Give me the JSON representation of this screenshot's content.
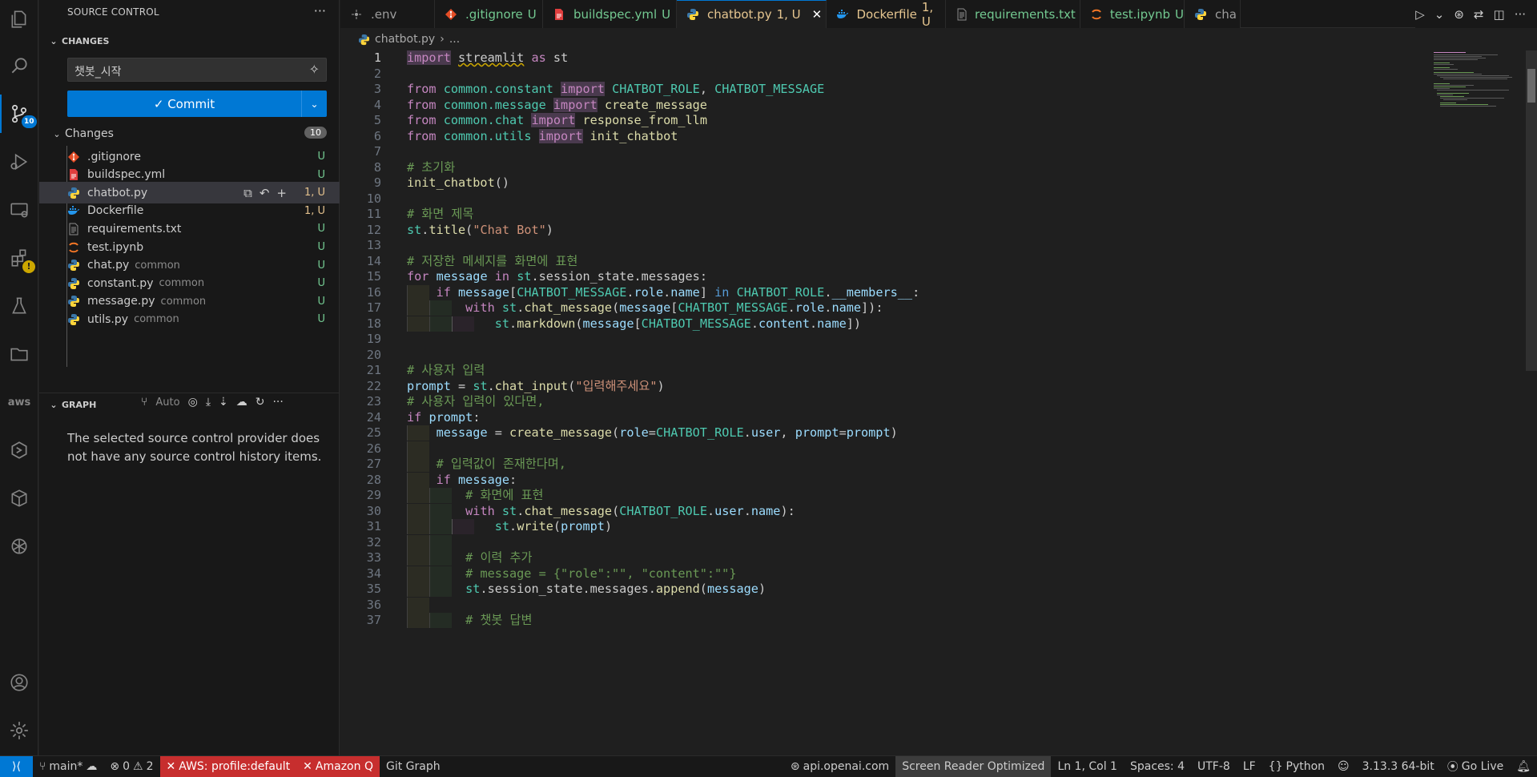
{
  "activity_bar": {
    "items": [
      {
        "name": "explorer-icon"
      },
      {
        "name": "search-icon"
      },
      {
        "name": "source-control-icon",
        "badge": "10"
      },
      {
        "name": "run-debug-icon"
      },
      {
        "name": "remote-explorer-icon"
      },
      {
        "name": "extensions-icon",
        "badge": "!"
      },
      {
        "name": "testing-icon"
      },
      {
        "name": "folder-icon"
      },
      {
        "name": "aws-icon",
        "label": "aws"
      },
      {
        "name": "hexagon-icon"
      },
      {
        "name": "cube-icon"
      },
      {
        "name": "openai-icon"
      }
    ],
    "bottom": [
      {
        "name": "account-icon"
      },
      {
        "name": "settings-gear-icon"
      }
    ]
  },
  "sidebar": {
    "title": "SOURCE CONTROL",
    "more": "···",
    "changes_section": "CHANGES",
    "commit_message": "챗봇_시작",
    "commit_label": "✓ Commit",
    "changes_group": "Changes",
    "changes_count": "10",
    "files": [
      {
        "name": ".gitignore",
        "dir": "",
        "status": "U",
        "icon": "git",
        "color": "#e44d26"
      },
      {
        "name": "buildspec.yml",
        "dir": "",
        "status": "U",
        "icon": "yaml",
        "color": "#e03e3e"
      },
      {
        "name": "chatbot.py",
        "dir": "",
        "status": "1, U",
        "icon": "python",
        "color": "#3572a5",
        "selected": true
      },
      {
        "name": "Dockerfile",
        "dir": "",
        "status": "1, U",
        "icon": "docker",
        "color": "#2496ed"
      },
      {
        "name": "requirements.txt",
        "dir": "",
        "status": "U",
        "icon": "text",
        "color": "#8b8b8b"
      },
      {
        "name": "test.ipynb",
        "dir": "",
        "status": "U",
        "icon": "jupyter",
        "color": "#f37626"
      },
      {
        "name": "chat.py",
        "dir": "common",
        "status": "U",
        "icon": "python",
        "color": "#3572a5"
      },
      {
        "name": "constant.py",
        "dir": "common",
        "status": "U",
        "icon": "python",
        "color": "#3572a5"
      },
      {
        "name": "message.py",
        "dir": "common",
        "status": "U",
        "icon": "python",
        "color": "#3572a5"
      },
      {
        "name": "utils.py",
        "dir": "common",
        "status": "U",
        "icon": "python",
        "color": "#3572a5"
      }
    ],
    "graph_section": "GRAPH",
    "graph_auto": "Auto",
    "graph_empty": "The selected source control provider does not have any source control history items."
  },
  "tabs": [
    {
      "label": ".env",
      "status": "",
      "icon": "env"
    },
    {
      "label": ".gitignore",
      "status": "U",
      "icon": "git"
    },
    {
      "label": "buildspec.yml",
      "status": "U",
      "icon": "yaml"
    },
    {
      "label": "chatbot.py",
      "status": "1, U",
      "icon": "python",
      "active": true
    },
    {
      "label": "Dockerfile",
      "status": "1, U",
      "icon": "docker"
    },
    {
      "label": "requirements.txt",
      "status": "U",
      "icon": "text"
    },
    {
      "label": "test.ipynb",
      "status": "U",
      "icon": "jupyter"
    },
    {
      "label": "cha",
      "status": "",
      "icon": "python"
    }
  ],
  "breadcrumb": {
    "file": "chatbot.py",
    "rest": "..."
  },
  "editor": {
    "lines": [
      {
        "n": "1",
        "html": "<span class=\"kw hl\">import</span> <span class=\"squig\">streamlit</span> <span class=\"kw\">as</span> st"
      },
      {
        "n": "2",
        "html": ""
      },
      {
        "n": "3",
        "html": "<span class=\"kw\">from</span> <span class=\"cls\">common.constant</span> <span class=\"kw hl\">import</span> <span class=\"cls\">CHATBOT_ROLE</span>, <span class=\"cls\">CHATBOT_MESSAGE</span>"
      },
      {
        "n": "4",
        "html": "<span class=\"kw\">from</span> <span class=\"cls\">common.message</span> <span class=\"kw hl\">import</span> <span class=\"fn\">create_message</span>"
      },
      {
        "n": "5",
        "html": "<span class=\"kw\">from</span> <span class=\"cls\">common.chat</span> <span class=\"kw hl\">import</span> <span class=\"fn\">response_from_llm</span>"
      },
      {
        "n": "6",
        "html": "<span class=\"kw\">from</span> <span class=\"cls\">common.utils</span> <span class=\"kw hl\">import</span> <span class=\"fn\">init_chatbot</span>"
      },
      {
        "n": "7",
        "html": ""
      },
      {
        "n": "8",
        "html": "<span class=\"cm\"># 초기화</span>"
      },
      {
        "n": "9",
        "html": "<span class=\"fn\">init_chatbot</span>()"
      },
      {
        "n": "10",
        "html": ""
      },
      {
        "n": "11",
        "html": "<span class=\"cm\"># 화면 제목</span>"
      },
      {
        "n": "12",
        "html": "<span class=\"cls\">st</span>.<span class=\"fn\">title</span>(<span class=\"str\">\"Chat Bot\"</span>)"
      },
      {
        "n": "13",
        "html": ""
      },
      {
        "n": "14",
        "html": "<span class=\"cm\"># 저장한 메세지를 화면에 표현</span>"
      },
      {
        "n": "15",
        "html": "<span class=\"kw\">for</span> <span class=\"var\">message</span> <span class=\"kw\">in</span> <span class=\"cls\">st</span>.session_state.messages:",
        "indent": 0
      },
      {
        "n": "16",
        "html": "    <span class=\"kw\">if</span> <span class=\"var\">message</span>[<span class=\"cls\">CHATBOT_MESSAGE</span>.<span class=\"var\">role</span>.<span class=\"var\">name</span>] <span class=\"kb\">in</span> <span class=\"cls\">CHATBOT_ROLE</span>.<span class=\"var\">__members__</span>:",
        "indent": 1
      },
      {
        "n": "17",
        "html": "        <span class=\"kw\">with</span> <span class=\"cls\">st</span>.<span class=\"fn\">chat_message</span>(<span class=\"var\">message</span>[<span class=\"cls\">CHATBOT_MESSAGE</span>.<span class=\"var\">role</span>.<span class=\"var\">name</span>]):",
        "indent": 2
      },
      {
        "n": "18",
        "html": "            <span class=\"cls\">st</span>.<span class=\"fn\">markdown</span>(<span class=\"var\">message</span>[<span class=\"cls\">CHATBOT_MESSAGE</span>.<span class=\"var\">content</span>.<span class=\"var\">name</span>])",
        "indent": 3
      },
      {
        "n": "19",
        "html": ""
      },
      {
        "n": "20",
        "html": ""
      },
      {
        "n": "21",
        "html": "<span class=\"cm\"># 사용자 입력</span>"
      },
      {
        "n": "22",
        "html": "<span class=\"var\">prompt</span> = <span class=\"cls\">st</span>.<span class=\"fn\">chat_input</span>(<span class=\"str\">\"입력해주세요\"</span>)"
      },
      {
        "n": "23",
        "html": "<span class=\"cm\"># 사용자 입력이 있다면,</span>"
      },
      {
        "n": "24",
        "html": "<span class=\"kw\">if</span> <span class=\"var\">prompt</span>:"
      },
      {
        "n": "25",
        "html": "    <span class=\"var\">message</span> = <span class=\"fn\">create_message</span>(<span class=\"var\">role</span>=<span class=\"cls\">CHATBOT_ROLE</span>.<span class=\"var\">user</span>, <span class=\"var\">prompt</span>=<span class=\"var\">prompt</span>)",
        "indent": 1
      },
      {
        "n": "26",
        "html": "",
        "indent": 1
      },
      {
        "n": "27",
        "html": "    <span class=\"cm\"># 입력값이 존재한다며,</span>",
        "indent": 1
      },
      {
        "n": "28",
        "html": "    <span class=\"kw\">if</span> <span class=\"var\">message</span>:",
        "indent": 1
      },
      {
        "n": "29",
        "html": "        <span class=\"cm\"># 화면에 표현</span>",
        "indent": 2
      },
      {
        "n": "30",
        "html": "        <span class=\"kw\">with</span> <span class=\"cls\">st</span>.<span class=\"fn\">chat_message</span>(<span class=\"cls\">CHATBOT_ROLE</span>.<span class=\"var\">user</span>.<span class=\"var\">name</span>):",
        "indent": 2
      },
      {
        "n": "31",
        "html": "            <span class=\"cls\">st</span>.<span class=\"fn\">write</span>(<span class=\"var\">prompt</span>)",
        "indent": 3
      },
      {
        "n": "32",
        "html": "",
        "indent": 2
      },
      {
        "n": "33",
        "html": "        <span class=\"cm\"># 이력 추가</span>",
        "indent": 2
      },
      {
        "n": "34",
        "html": "        <span class=\"cm\"># message = {\"role\":\"\", \"content\":\"\"}</span>",
        "indent": 2
      },
      {
        "n": "35",
        "html": "        <span class=\"cls\">st</span>.session_state.messages.<span class=\"fn\">append</span>(<span class=\"var\">message</span>)",
        "indent": 2
      },
      {
        "n": "36",
        "html": "",
        "indent": 1
      },
      {
        "n": "37",
        "html": "        <span class=\"cm\"># 챗봇 답변</span>",
        "indent": 2
      }
    ]
  },
  "status_bar": {
    "remote": "⟩⟨",
    "branch": "main*",
    "errors": "0",
    "warnings": "2",
    "aws": "AWS: profile:default",
    "amazon_q": "Amazon Q",
    "git_graph": "Git Graph",
    "openai": "api.openai.com",
    "screen_reader": "Screen Reader Optimized",
    "position": "Ln 1, Col 1",
    "spaces": "Spaces: 4",
    "encoding": "UTF-8",
    "eol": "LF",
    "language": "Python",
    "python_version": "3.13.3 64-bit",
    "go_live": "Go Live"
  }
}
